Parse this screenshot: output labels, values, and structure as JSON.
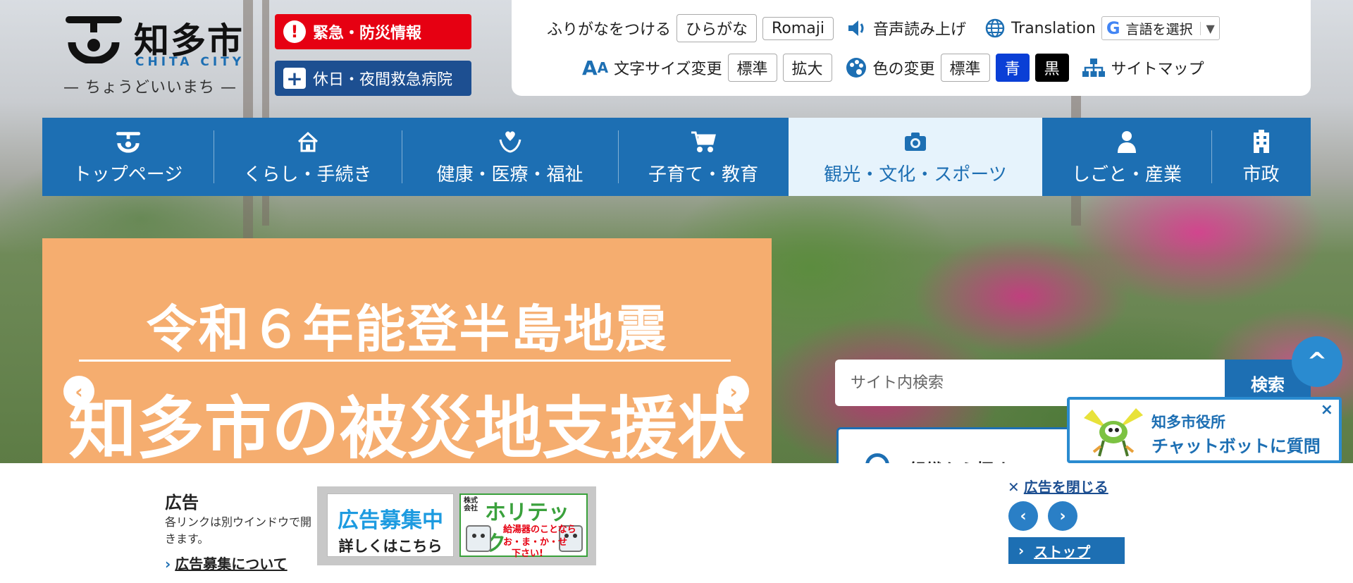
{
  "logo": {
    "name": "知多市",
    "english": "CHITA CITY",
    "slogan": "— ちょうどいいまち —"
  },
  "emergency": {
    "disaster_label": "緊急・防災情報",
    "hospital_label": "休日・夜間救急病院"
  },
  "utility": {
    "furigana_label": "ふりがなをつける",
    "hiragana_btn": "ひらがな",
    "romaji_btn": "Romaji",
    "speech_label": "音声読み上げ",
    "translation_label": "Translation",
    "language_select": "言語を選択",
    "fontsize_label": "文字サイズ変更",
    "fontsize_standard": "標準",
    "fontsize_large": "拡大",
    "color_label": "色の変更",
    "color_standard": "標準",
    "color_blue": "青",
    "color_black": "黒",
    "sitemap_label": "サイトマップ"
  },
  "gnav": {
    "items": [
      {
        "label": "トップページ",
        "icon": "city-emblem-icon"
      },
      {
        "label": "くらし・手続き",
        "icon": "house-icon"
      },
      {
        "label": "健康・医療・福祉",
        "icon": "heart-hands-icon"
      },
      {
        "label": "子育て・教育",
        "icon": "stroller-icon"
      },
      {
        "label": "観光・文化・スポーツ",
        "icon": "camera-icon"
      },
      {
        "label": "しごと・産業",
        "icon": "person-icon"
      },
      {
        "label": "市政",
        "icon": "building-icon"
      }
    ],
    "active_index": 4
  },
  "banner": {
    "title": "令和６年能登半島地震",
    "subtitle": "知多市の被災地支援状況"
  },
  "search": {
    "placeholder": "サイト内検索",
    "button_label": "検索"
  },
  "org_search": {
    "label": "組織から探す"
  },
  "chatbot": {
    "line1": "知多市役所",
    "line2": "チャットボットに質問",
    "close": "×"
  },
  "ads": {
    "heading": "広告",
    "note": "各リンクは別ウインドウで開きます。",
    "recruit_link": "広告募集について",
    "ad1_line1": "広告募集中",
    "ad1_line2": "詳しくはこちら",
    "ad2_kabushiki": "株式会社",
    "ad2_name": "ホリテック",
    "ad2_copy1": "給湯器のことなら",
    "ad2_copy2": "お・ま・か・せ",
    "ad2_copy3": "下さい!",
    "close_label": "広告を閉じる",
    "stop_label": "ストップ"
  },
  "colors": {
    "nav_blue": "#1d6fb3",
    "emergency_red": "#e60012",
    "hospital_navy": "#1d4f91",
    "banner_orange": "#f5ad6f"
  }
}
